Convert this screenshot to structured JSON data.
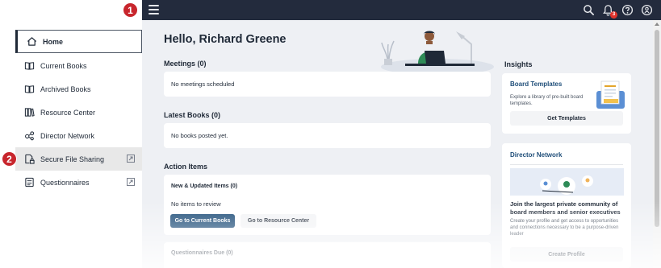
{
  "topbar": {
    "menu_icon": "hamburger-menu-icon",
    "icons": [
      "search-icon",
      "bell-icon",
      "help-icon",
      "user-icon"
    ],
    "notification_count": "3"
  },
  "steps": {
    "one": "1",
    "two": "2"
  },
  "sidebar": {
    "items": [
      {
        "label": "Home",
        "icon": "home-icon",
        "active": true
      },
      {
        "label": "Current Books",
        "icon": "book-open-icon"
      },
      {
        "label": "Archived Books",
        "icon": "book-open-icon"
      },
      {
        "label": "Resource Center",
        "icon": "books-icon"
      },
      {
        "label": "Director Network",
        "icon": "network-icon"
      },
      {
        "label": "Secure File Sharing",
        "icon": "secure-file-icon",
        "external": true
      },
      {
        "label": "Questionnaires",
        "icon": "questionnaire-icon",
        "external": true
      }
    ]
  },
  "main": {
    "greeting": "Hello, Richard Greene",
    "meetings": {
      "title": "Meetings (0)",
      "empty": "No meetings scheduled"
    },
    "latest_books": {
      "title": "Latest Books (0)",
      "empty": "No books posted yet."
    },
    "action_items": {
      "title": "Action Items",
      "new_updated": "New & Updated Items (0)",
      "no_items": "No items to review",
      "btn_current_books": "Go to Current Books",
      "btn_resource_center": "Go to Resource Center",
      "questionnaires_due": "Questionnaires Due (0)"
    }
  },
  "insights": {
    "title": "Insights",
    "board_templates": {
      "heading": "Board Templates",
      "description": "Explore a library of pre-built board templates.",
      "button": "Get Templates"
    },
    "director_network": {
      "heading": "Director Network",
      "tagline": "Join the largest private community of board members and senior executives",
      "description": "Create your profile and get access to opportunities and connections necessary to be a purpose-driven leader",
      "button": "Create Profile"
    }
  },
  "colors": {
    "topbar": "#232b3d",
    "primary": "#1f4e79",
    "step_marker": "#c8262d",
    "badge": "#e0332b"
  }
}
